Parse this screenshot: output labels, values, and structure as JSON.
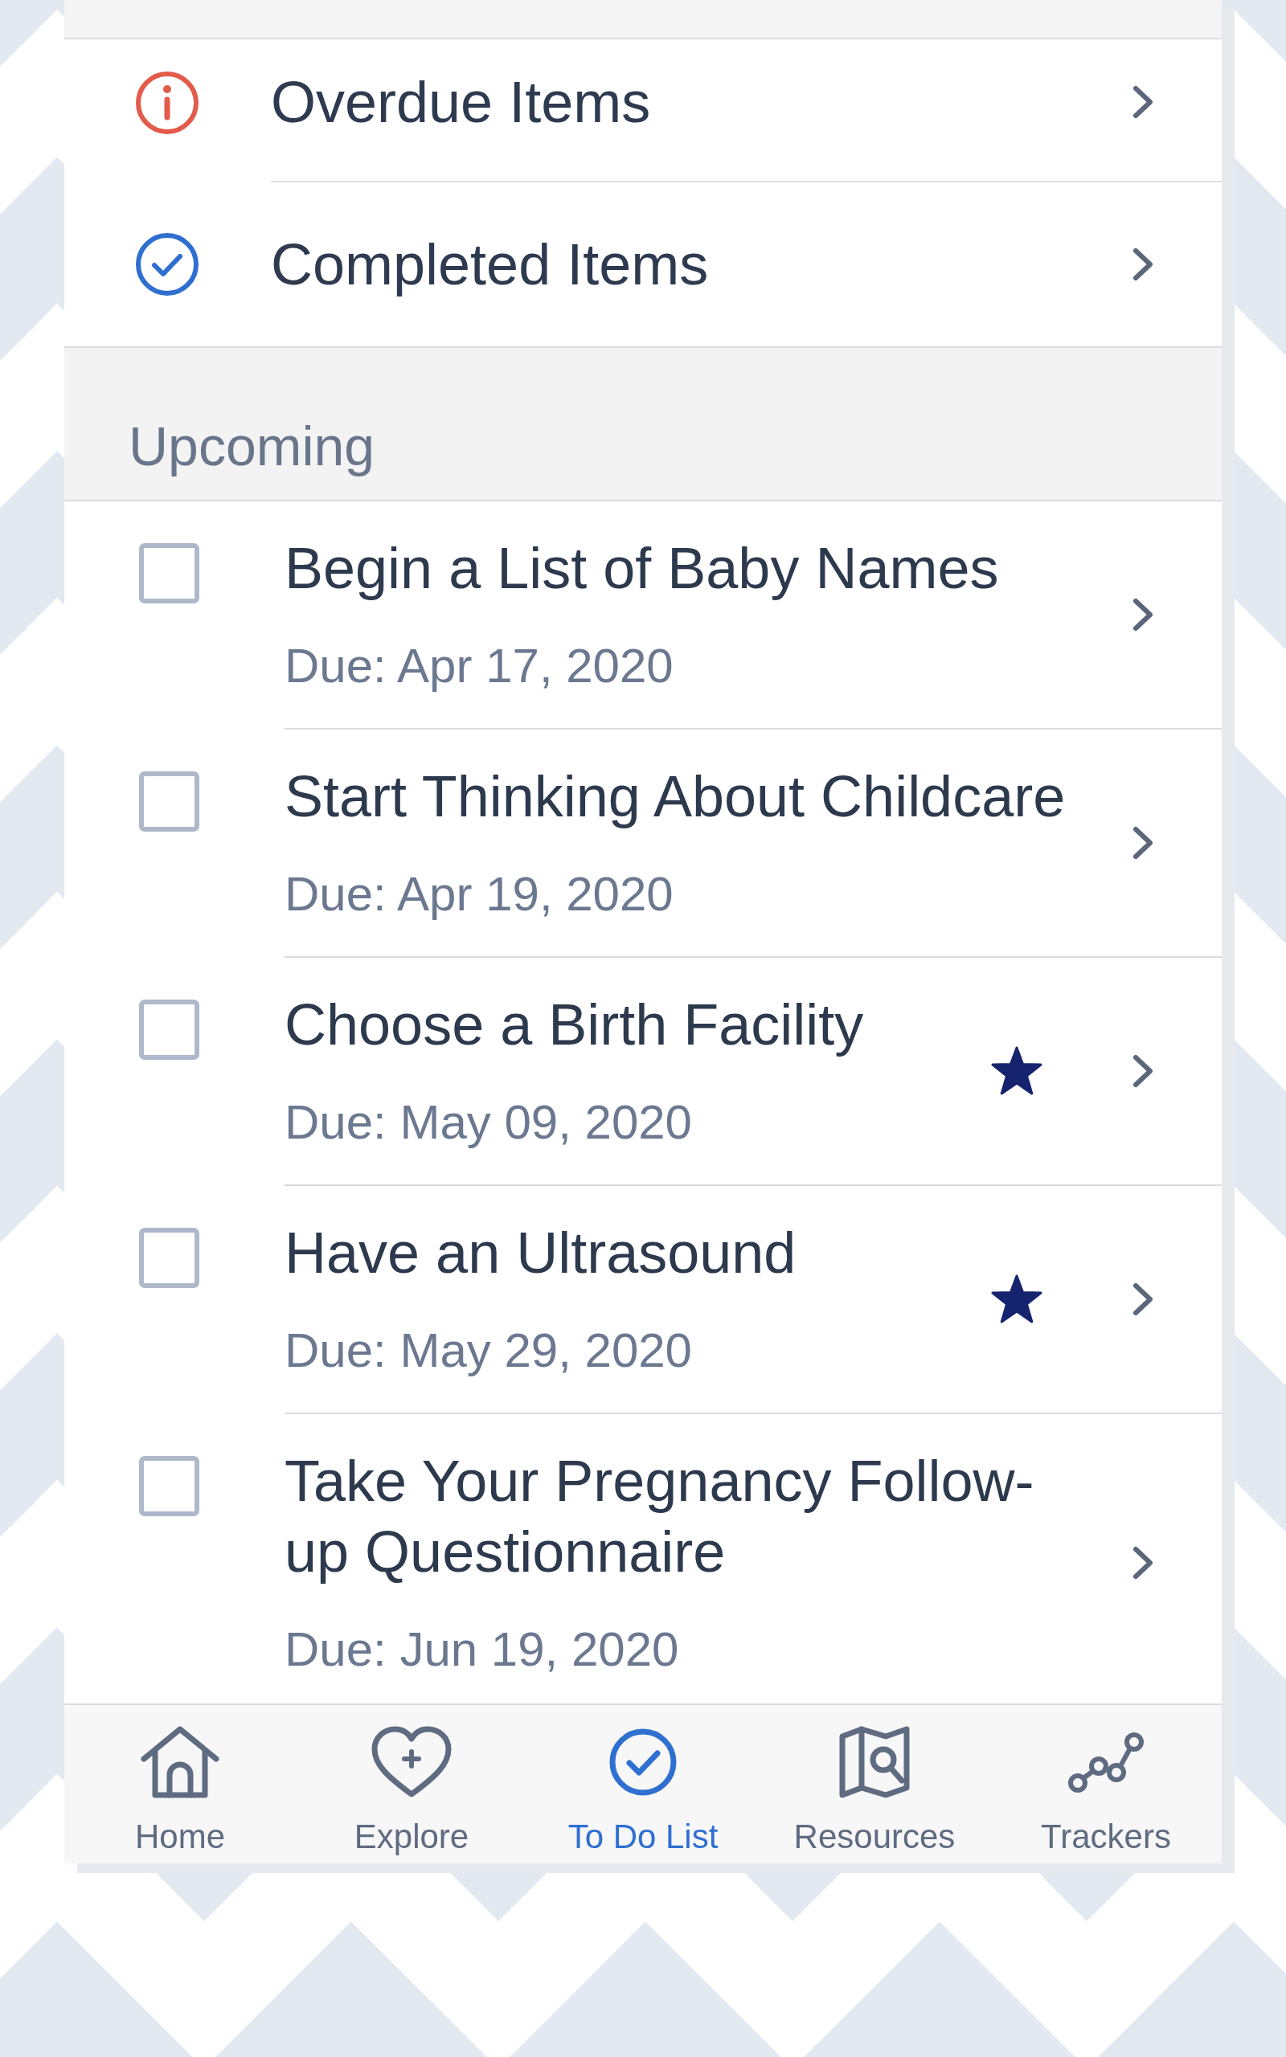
{
  "top_links": [
    {
      "kind": "overdue",
      "label": "Overdue Items"
    },
    {
      "kind": "completed",
      "label": "Completed Items"
    }
  ],
  "upcoming": {
    "title": "Upcoming",
    "items": [
      {
        "title": "Begin a List of Baby Names",
        "due": "Due: Apr 17, 2020",
        "checked": false,
        "starred": false
      },
      {
        "title": "Start Thinking About Childcare",
        "due": "Due: Apr 19, 2020",
        "checked": false,
        "starred": false
      },
      {
        "title": "Choose a Birth Facility",
        "due": "Due: May 09, 2020",
        "checked": false,
        "starred": true
      },
      {
        "title": "Have an Ultrasound",
        "due": "Due: May 29, 2020",
        "checked": false,
        "starred": true
      },
      {
        "title": "Take Your Pregnancy Follow-up Questionnaire",
        "due": "Due: Jun 19, 2020",
        "checked": false,
        "starred": false
      }
    ]
  },
  "bottom_nav": [
    {
      "kind": "home",
      "label": "Home",
      "selected": false
    },
    {
      "kind": "explore",
      "label": "Explore",
      "selected": false
    },
    {
      "kind": "todo",
      "label": "To Do List",
      "selected": true
    },
    {
      "kind": "resources",
      "label": "Resources",
      "selected": false
    },
    {
      "kind": "trackers",
      "label": "Trackers",
      "selected": false
    }
  ]
}
